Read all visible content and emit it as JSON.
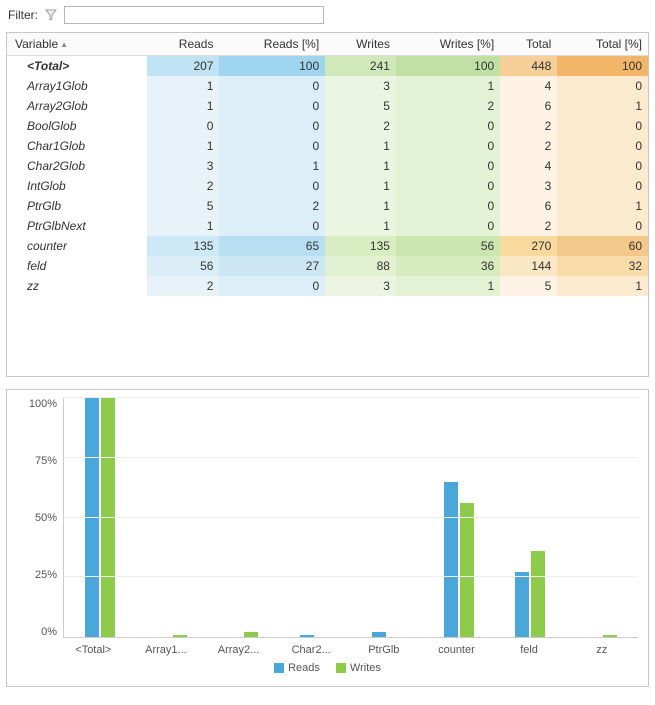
{
  "filter": {
    "label": "Filter:",
    "value": ""
  },
  "table": {
    "headers": [
      "Variable",
      "Reads",
      "Reads [%]",
      "Writes",
      "Writes [%]",
      "Total",
      "Total [%]"
    ],
    "rows": [
      {
        "k": "total",
        "bold": true,
        "v": [
          "<Total>",
          "207",
          "100",
          "241",
          "100",
          "448",
          "100"
        ]
      },
      {
        "k": "",
        "v": [
          "Array1Glob",
          "1",
          "0",
          "3",
          "1",
          "4",
          "0"
        ]
      },
      {
        "k": "",
        "v": [
          "Array2Glob",
          "1",
          "0",
          "5",
          "2",
          "6",
          "1"
        ]
      },
      {
        "k": "",
        "v": [
          "BoolGlob",
          "0",
          "0",
          "2",
          "0",
          "2",
          "0"
        ]
      },
      {
        "k": "",
        "v": [
          "Char1Glob",
          "1",
          "0",
          "1",
          "0",
          "2",
          "0"
        ]
      },
      {
        "k": "",
        "v": [
          "Char2Glob",
          "3",
          "1",
          "1",
          "0",
          "4",
          "0"
        ]
      },
      {
        "k": "",
        "v": [
          "IntGlob",
          "2",
          "0",
          "1",
          "0",
          "3",
          "0"
        ]
      },
      {
        "k": "",
        "v": [
          "PtrGlb",
          "5",
          "2",
          "1",
          "0",
          "6",
          "1"
        ]
      },
      {
        "k": "",
        "v": [
          "PtrGlbNext",
          "1",
          "0",
          "1",
          "0",
          "2",
          "0"
        ]
      },
      {
        "k": "counter",
        "v": [
          "counter",
          "135",
          "65",
          "135",
          "56",
          "270",
          "60"
        ]
      },
      {
        "k": "feld",
        "v": [
          "feld",
          "56",
          "27",
          "88",
          "36",
          "144",
          "32"
        ]
      },
      {
        "k": "",
        "v": [
          "zz",
          "2",
          "0",
          "3",
          "1",
          "5",
          "1"
        ]
      }
    ]
  },
  "chart_data": {
    "type": "bar",
    "ylabel": "",
    "xlabel": "",
    "ylim": [
      0,
      100
    ],
    "y_ticks": [
      "0%",
      "25%",
      "50%",
      "75%",
      "100%"
    ],
    "categories": [
      "<Total>",
      "Array1...",
      "Array2...",
      "Char2...",
      "PtrGlb",
      "counter",
      "feld",
      "zz"
    ],
    "series": [
      {
        "name": "Reads",
        "values": [
          100,
          0,
          0,
          1,
          2,
          65,
          27,
          0
        ]
      },
      {
        "name": "Writes",
        "values": [
          100,
          1,
          2,
          0,
          0,
          56,
          36,
          1
        ]
      }
    ],
    "legend": [
      "Reads",
      "Writes"
    ]
  }
}
